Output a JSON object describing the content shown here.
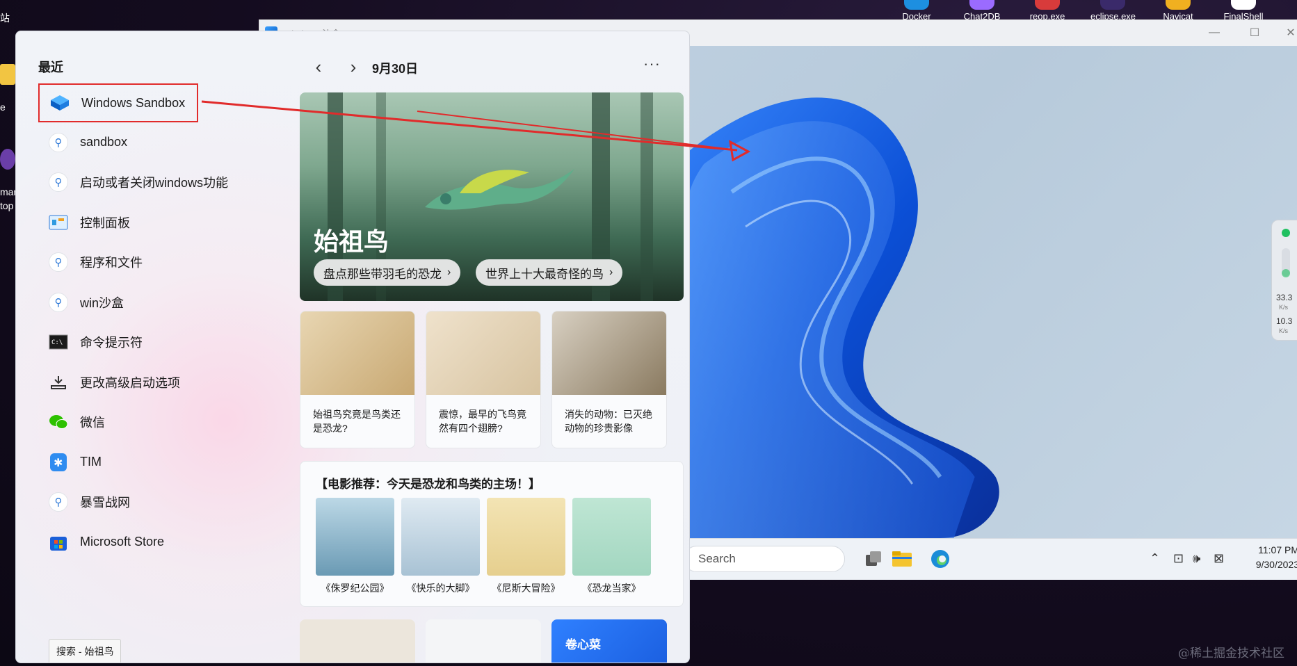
{
  "desktop": {
    "left_labels": [
      "站",
      "e",
      "mar",
      "top"
    ],
    "top_icons": [
      {
        "label": "Docker",
        "color": "#1d8fe0"
      },
      {
        "label": "Chat2DB",
        "color": "#9b6bff"
      },
      {
        "label": "reop.exe",
        "color": "#d83b3b"
      },
      {
        "label": "eclipse.exe",
        "color": "#3a2a6a"
      },
      {
        "label": "Navicat",
        "color": "#f0b020"
      },
      {
        "label": "FinalShell",
        "color": "#ffffff"
      }
    ],
    "watermark": "@稀土掘金技术社区"
  },
  "sandbox_window": {
    "title": "Windows 沙盒",
    "controls": {
      "minimize": "—",
      "maximize": "☐",
      "close": "✕"
    },
    "taskbar": {
      "search_placeholder": "Search",
      "clock_time": "11:07 PM",
      "clock_date": "9/30/2023"
    }
  },
  "net_widget": {
    "up": "33.3",
    "up_unit": "K/s",
    "down": "10.3",
    "down_unit": "K/s"
  },
  "start_menu": {
    "recent_title": "最近",
    "recent_items": [
      {
        "label": "Windows Sandbox",
        "icon": "sandbox-icon"
      },
      {
        "label": "sandbox",
        "icon": "search-icon"
      },
      {
        "label": "启动或者关闭windows功能",
        "icon": "search-icon"
      },
      {
        "label": "控制面板",
        "icon": "control-panel-icon"
      },
      {
        "label": "程序和文件",
        "icon": "search-icon"
      },
      {
        "label": "win沙盒",
        "icon": "search-icon"
      },
      {
        "label": "命令提示符",
        "icon": "terminal-icon"
      },
      {
        "label": "更改高级启动选项",
        "icon": "advanced-startup-icon"
      },
      {
        "label": "微信",
        "icon": "wechat-icon"
      },
      {
        "label": "TIM",
        "icon": "tim-icon"
      },
      {
        "label": "暴雪战网",
        "icon": "search-icon"
      },
      {
        "label": "Microsoft Store",
        "icon": "store-icon"
      }
    ],
    "tooltip": "搜索 - 始祖鸟",
    "date": "9月30日",
    "more": "···",
    "hero": {
      "title": "始祖鸟",
      "pills": [
        "盘点那些带羽毛的恐龙",
        "世界上十大最奇怪的鸟"
      ]
    },
    "cards": [
      {
        "text": "始祖鸟究竟是鸟类还是恐龙?"
      },
      {
        "text": "震惊，最早的飞鸟竟然有四个翅膀?"
      },
      {
        "text": "消失的动物：已灭绝动物的珍贵影像"
      }
    ],
    "movies": {
      "title": "【电影推荐：今天是恐龙和鸟类的主场！】",
      "items": [
        "《侏罗纪公园》",
        "《快乐的大脚》",
        "《尼斯大冒险》",
        "《恐龙当家》"
      ]
    },
    "bottom_cards": {
      "third_title": "卷心菜"
    }
  }
}
